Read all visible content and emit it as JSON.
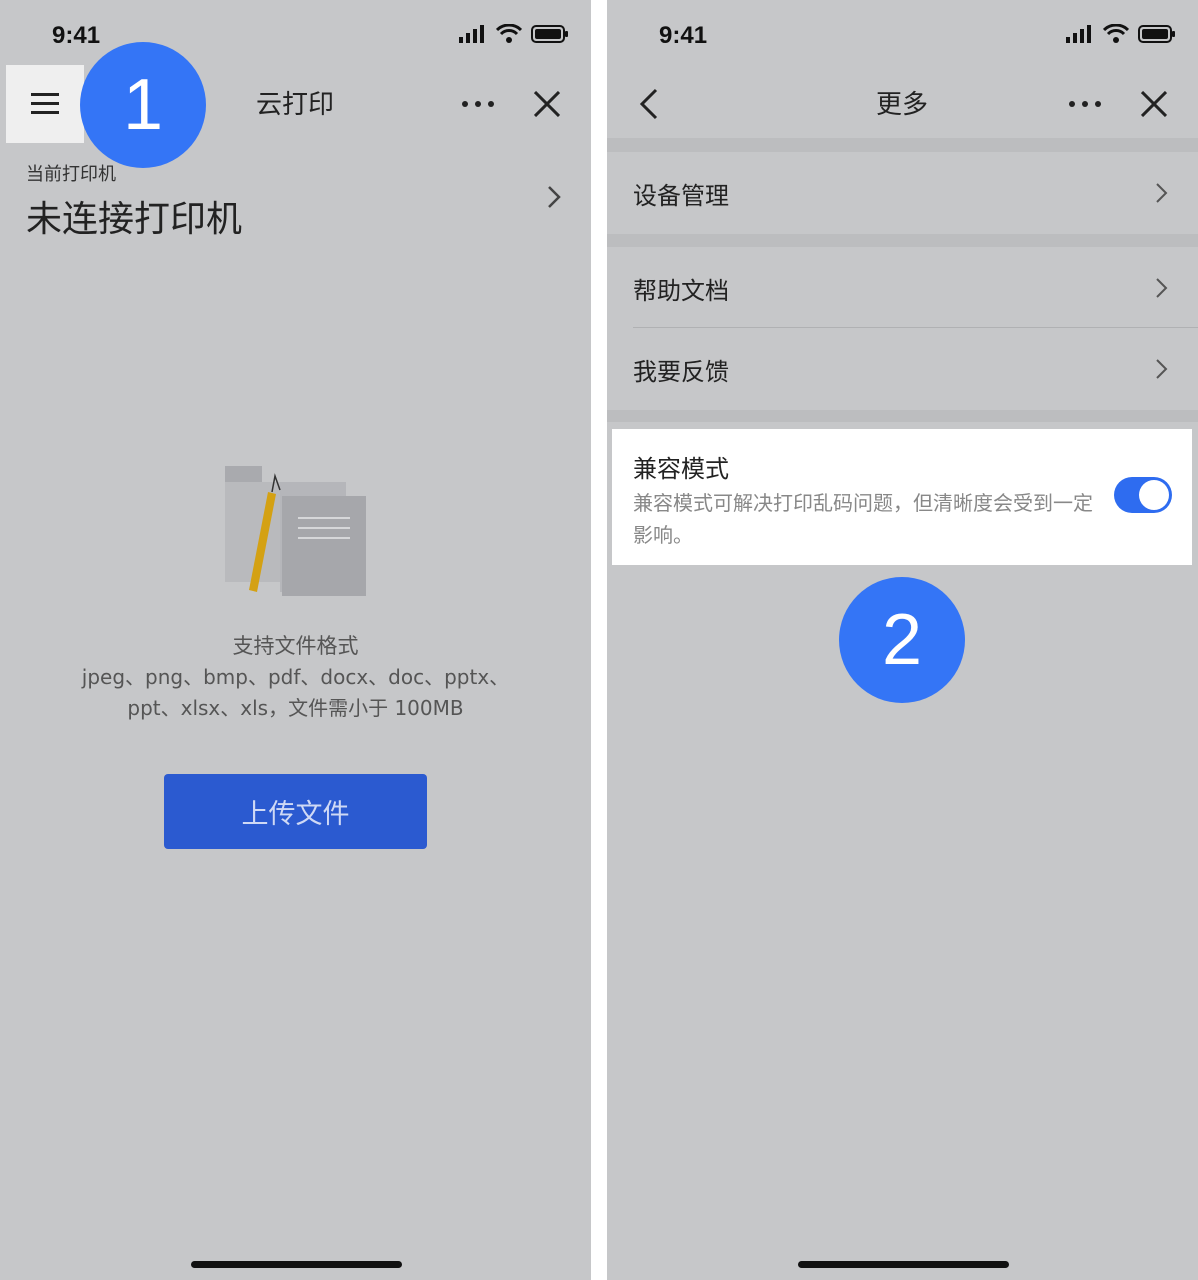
{
  "left": {
    "status_time": "9:41",
    "nav": {
      "title": "云打印"
    },
    "step_number": "1",
    "printer": {
      "label": "当前打印机",
      "value": "未连接打印机"
    },
    "formats": {
      "title": "支持文件格式",
      "line1": "jpeg、png、bmp、pdf、docx、doc、pptx、",
      "line2": "ppt、xlsx、xls，文件需小于 100MB"
    },
    "upload_button": "上传文件"
  },
  "right": {
    "status_time": "9:41",
    "nav": {
      "title": "更多"
    },
    "menu": [
      {
        "label": "设备管理"
      },
      {
        "label": "帮助文档"
      },
      {
        "label": "我要反馈"
      }
    ],
    "compat": {
      "title": "兼容模式",
      "desc": "兼容模式可解决打印乱码问题，但清晰度会受到一定影响。",
      "enabled": true
    },
    "step_number": "2"
  },
  "colors": {
    "accent": "#3475f6",
    "button": "#2b5ad0",
    "background": "#c6c7c9",
    "toggle_on": "#2e6cf0"
  }
}
